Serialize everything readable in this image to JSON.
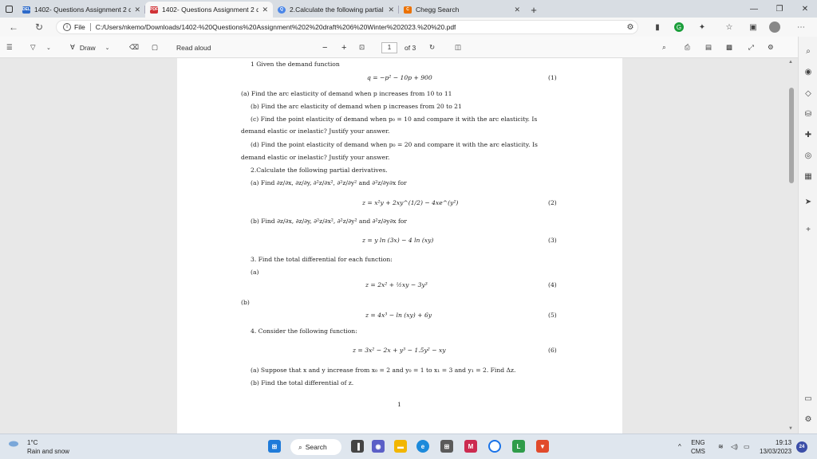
{
  "tabs": [
    {
      "label": "1402- Questions Assignment 2 d",
      "favicon": "DEL",
      "favicon_color": "#2d6ac9",
      "active": false
    },
    {
      "label": "1402- Questions Assignment 2 d",
      "favicon": "PDF",
      "favicon_color": "#d13438",
      "active": true
    },
    {
      "label": "2.Calculate the following partial",
      "favicon": "Q",
      "favicon_color": "#4a86e8",
      "active": false
    },
    {
      "label": "Chegg Search",
      "favicon": "C",
      "favicon_color": "#eb7100",
      "active": false
    }
  ],
  "address": {
    "scheme_label": "File",
    "url": "C:/Users/nkemo/Downloads/1402-%20Questions%20Assignment%202%20draft%206%20Winter%202023.%20%20.pdf"
  },
  "pdf_toolbar": {
    "draw_label": "Draw",
    "read_aloud_label": "Read aloud",
    "page_number": "1",
    "page_total": "of 3"
  },
  "document": {
    "lines": [
      "1 Given the demand function",
      "q = −p² − 10p + 900",
      "(1)",
      "(a) Find the arc elasticity of demand when p increases from 10 to 11",
      "(b) Find the arc elasticity of demand when p increases from 20 to 21",
      "(c) Find the point elasticity of demand when p₀ = 10 and compare it with the arc elasticity. Is",
      "demand elastic or inelastic? Justify your answer.",
      "(d) Find the point elasticity of demand when p₀ = 20 and compare it with the arc elasticity. Is",
      "demand elastic or inelastic? Justify your answer.",
      "2.Calculate the following partial derivatives.",
      "(a) Find ∂z/∂x, ∂z/∂y, ∂²z/∂x², ∂²z/∂y² and ∂²z/∂y∂x for",
      "z = x²y + 2xy^(1/2) − 4xe^(y²)",
      "(2)",
      "(b) Find ∂z/∂x, ∂z/∂y, ∂²z/∂x², ∂²z/∂y² and ∂²z/∂y∂x for",
      "z = y ln (3x) − 4 ln (xy)",
      "(3)",
      "3. Find the total differential for each function:",
      "(a)",
      "z = 2x² + ½xy − 3y³",
      "(4)",
      "(b)",
      "z = 4x³ − ln (xy) + 6y",
      "(5)",
      "4. Consider the following function:",
      "z = 3x² − 2x + y³ − 1.5y² − xy",
      "(6)",
      "(a) Suppose that x and y increase from x₀ = 2 and y₀ = 1 to x₁ = 3 and y₁ = 2. Find Δz.",
      "(b) Find the total differential of z.",
      "1"
    ]
  },
  "taskbar": {
    "temperature": "1°C",
    "weather": "Rain and snow",
    "search_label": "Search",
    "lang_line1": "ENG",
    "lang_line2": "CMS",
    "time": "19:13",
    "date": "13/03/2023",
    "notification_count": "24"
  }
}
